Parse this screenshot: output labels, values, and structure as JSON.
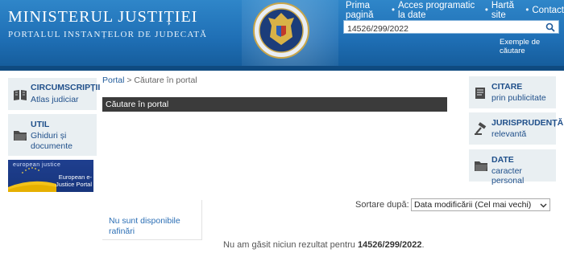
{
  "header": {
    "title": "MINISTERUL JUSTIȚIEI",
    "subtitle": "PORTALUL INSTANȚELOR DE JUDECATĂ",
    "nav": [
      "Prima pagină",
      "Acces programatic la date",
      "Hartă site",
      "Contact"
    ],
    "search_value": "14526/299/2022",
    "search_examples": "Exemple de căutare"
  },
  "left_sidebar": {
    "circumscriptii": {
      "title": "CIRCUMSCRIPȚII",
      "sub": "Atlas judiciar"
    },
    "util": {
      "title": "UTIL",
      "sub": "Ghiduri și documente"
    },
    "ejustice": {
      "top": "european justice",
      "bottom": "European e-Justice Portal"
    }
  },
  "main": {
    "breadcrumb": {
      "portal": "Portal",
      "current": "> Căutare în portal"
    },
    "section_title": "Căutare în portal",
    "refine_text": "Nu sunt disponibile rafinări",
    "sort_label": "Sortare după:",
    "sort_value": "Data modificării (Cel mai vechi)",
    "no_results_prefix": "Nu am găsit niciun rezultat pentru",
    "no_results_query": "14526/299/2022",
    "no_results_suffix": "."
  },
  "right_sidebar": {
    "citare": {
      "title": "CITARE",
      "sub": "prin publicitate"
    },
    "jurisprudenta": {
      "title": "JURISPRUDENȚĂ",
      "sub": "relevantă"
    },
    "date": {
      "title": "DATE",
      "sub": "caracter personal"
    }
  },
  "colors": {
    "header_blue": "#1f6fb5",
    "link_blue": "#1f5a9a",
    "section_bar": "#3b3b3b",
    "card_bg": "#e9eff2"
  },
  "icons": [
    "book-icon",
    "folder-icon",
    "document-list-icon",
    "gavel-icon",
    "folder-icon",
    "search-icon",
    "chevron-down-icon",
    "romania-emblem"
  ]
}
